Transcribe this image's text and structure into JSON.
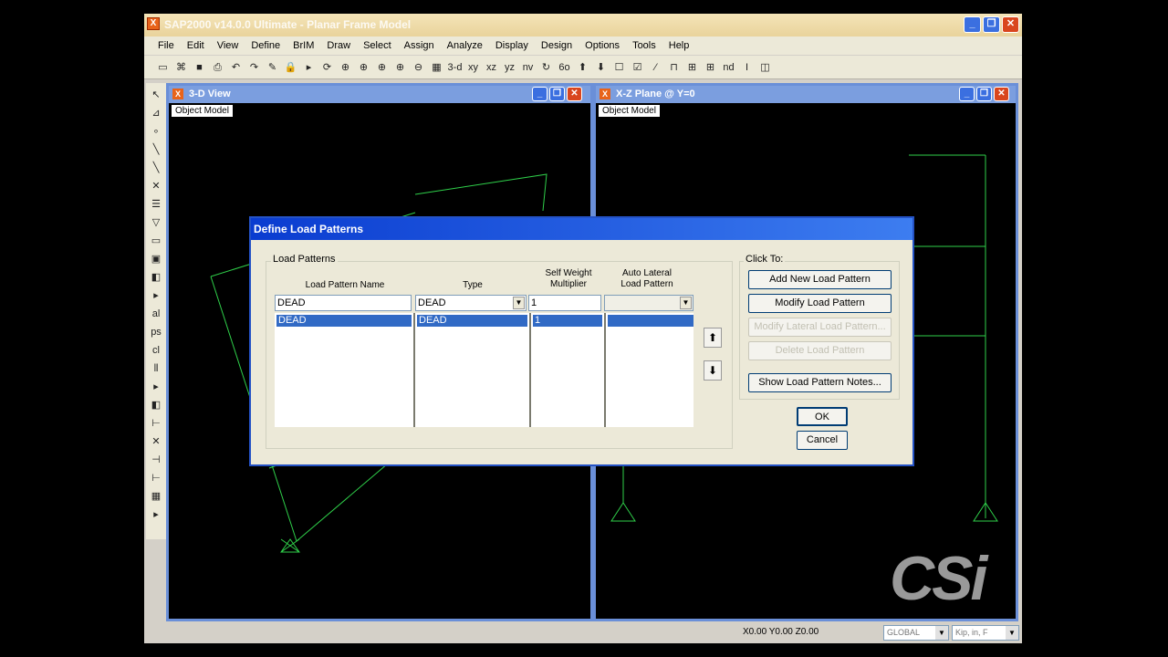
{
  "app": {
    "title": "SAP2000 v14.0.0 Ultimate - Planar Frame Model",
    "icon": "sap-app-icon",
    "window_buttons": [
      "_",
      "❐",
      "✕"
    ]
  },
  "menu": [
    "File",
    "Edit",
    "View",
    "Define",
    "BrIM",
    "Draw",
    "Select",
    "Assign",
    "Analyze",
    "Display",
    "Design",
    "Options",
    "Tools",
    "Help"
  ],
  "toolbar": [
    "▭",
    "⌘",
    "■",
    "⎙",
    "↶",
    "↷",
    "✎",
    "🔒",
    "▸",
    "⟳",
    "⊕",
    "⊕",
    "⊕",
    "⊕",
    "⊖",
    "▦",
    "3-d",
    "xy",
    "xz",
    "yz",
    "nv",
    "↻",
    "6o",
    "⬆",
    "⬇",
    "☐",
    "☑",
    "⁄",
    "⊓",
    "⊞",
    "⊞",
    "nd",
    "I",
    "◫"
  ],
  "left_toolbar": [
    "↖",
    "⊿",
    "∘",
    "╲",
    "╲",
    "✕",
    "☰",
    "▽",
    "▭",
    "▣",
    "◧",
    "▸",
    "al",
    "ps",
    "cl",
    "⫴",
    "▸",
    "◧",
    "⊢",
    "✕",
    "⊣",
    "⊢",
    "▦",
    "▸"
  ],
  "view3d": {
    "title": "3-D View",
    "object_model": "Object Model"
  },
  "viewxz": {
    "title": "X-Z Plane @ Y=0",
    "object_model": "Object Model"
  },
  "status": {
    "coords": "X0.00  Y0.00  Z0.00",
    "coord_system": "GLOBAL",
    "units": "Kip, in, F"
  },
  "logo": "CSi",
  "dialog": {
    "title": "Define Load Patterns",
    "load_patterns_group": "Load Patterns",
    "headers": {
      "name": "Load Pattern Name",
      "type": "Type",
      "self_weight": "Self Weight Multiplier",
      "auto_lateral": "Auto Lateral Load Pattern"
    },
    "input": {
      "name": "DEAD",
      "type": "DEAD",
      "self_weight": "1",
      "auto_lateral": ""
    },
    "rows": [
      {
        "name": "DEAD",
        "type": "DEAD",
        "self_weight": "1",
        "auto_lateral": ""
      }
    ],
    "click_to_group": "Click To:",
    "buttons": {
      "add": "Add New Load Pattern",
      "modify": "Modify Load Pattern",
      "modify_lateral": "Modify Lateral Load Pattern...",
      "delete": "Delete Load Pattern",
      "notes": "Show Load Pattern Notes...",
      "ok": "OK",
      "cancel": "Cancel"
    }
  }
}
